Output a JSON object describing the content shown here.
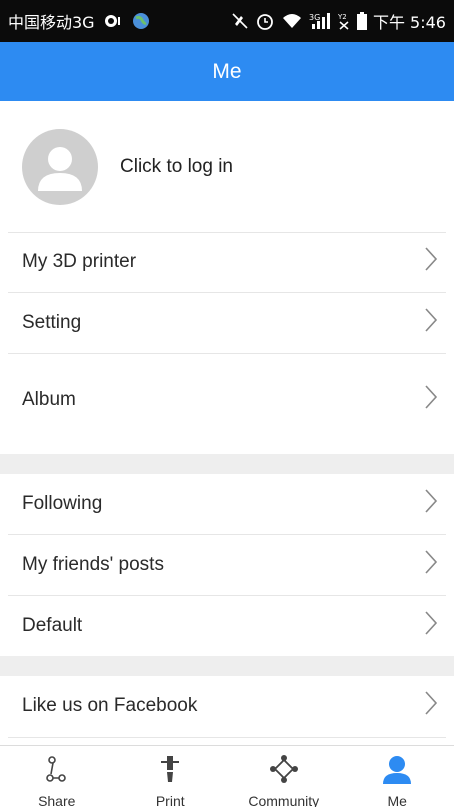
{
  "status_bar": {
    "carrier": "中国移动3G",
    "time": "下午 5:46",
    "icons": [
      "notification-icon",
      "globe-icon",
      "mute-icon",
      "alarm-icon",
      "wifi-icon",
      "signal-3g-icon",
      "no-sim-icon",
      "battery-icon"
    ]
  },
  "header": {
    "title": "Me"
  },
  "login": {
    "label": "Click to log in",
    "avatar_icon": "user-avatar-icon"
  },
  "menu": {
    "group1": [
      "My 3D printer",
      "Setting",
      "Album"
    ],
    "group2": [
      "Following",
      "My friends' posts",
      "Default"
    ],
    "group3": [
      "Like us on Facebook"
    ]
  },
  "bottom_nav": {
    "items": [
      {
        "label": "Share",
        "icon": "share-icon",
        "active": false
      },
      {
        "label": "Print",
        "icon": "print-icon",
        "active": false
      },
      {
        "label": "Community",
        "icon": "community-icon",
        "active": false
      },
      {
        "label": "Me",
        "icon": "me-icon",
        "active": true
      }
    ]
  },
  "colors": {
    "accent": "#2d8bf2",
    "status_bar_bg": "#0b0b0b",
    "separator": "#eeeeee",
    "text": "#2a2a2a"
  }
}
